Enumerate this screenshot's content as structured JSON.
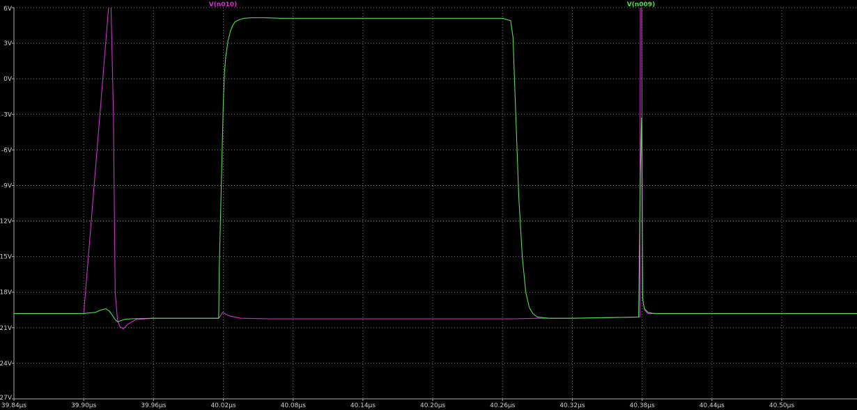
{
  "chart_data": {
    "type": "line",
    "title": "",
    "xlabel": "",
    "ylabel": "",
    "grid": true,
    "xlim": [
      39.84,
      40.5647
    ],
    "ylim": [
      -27,
      6
    ],
    "x_ticks": [
      39.84,
      39.9,
      39.96,
      40.02,
      40.08,
      40.14,
      40.2,
      40.26,
      40.32,
      40.38,
      40.44,
      40.5
    ],
    "x_tick_labels": [
      "39.84µs",
      "39.90µs",
      "39.96µs",
      "40.02µs",
      "40.08µs",
      "40.14µs",
      "40.20µs",
      "40.26µs",
      "40.32µs",
      "40.38µs",
      "40.44µs",
      "40.50µs"
    ],
    "y_ticks": [
      6,
      3,
      0,
      -3,
      -6,
      -9,
      -12,
      -15,
      -18,
      -21,
      -24,
      -27
    ],
    "y_tick_labels": [
      "6V",
      "3V",
      "0V",
      "-3V",
      "-6V",
      "-9V",
      "-12V",
      "-15V",
      "-18V",
      "-21V",
      "-24V",
      "-27V"
    ],
    "colors": {
      "background": "#000000",
      "grid": "#7a7a7a",
      "axis": "#b0b0b0",
      "text": "#d0d0d0"
    },
    "series": [
      {
        "name": "V(n010)",
        "color": "#d030d0",
        "x": [
          39.84,
          39.9,
          39.923,
          39.9255,
          39.927,
          39.929,
          39.931,
          39.934,
          39.938,
          39.945,
          39.96,
          39.99,
          40.016,
          40.0195,
          40.025,
          40.035,
          40.06,
          40.1,
          40.2,
          40.27,
          40.29,
          40.32,
          40.378,
          40.3785,
          40.3795,
          40.3805,
          40.382,
          40.385,
          40.39,
          40.42,
          40.5647
        ],
        "y": [
          -19.8,
          -19.8,
          8,
          -3,
          -18,
          -20.3,
          -20.9,
          -21.1,
          -20.7,
          -20.3,
          -20.2,
          -20.2,
          -20.2,
          -19.7,
          -20.0,
          -20.2,
          -20.25,
          -20.25,
          -20.25,
          -20.25,
          -20.2,
          -20.2,
          -20.1,
          8,
          8,
          -18.5,
          -19.5,
          -19.8,
          -19.8,
          -19.8,
          -19.8
        ]
      },
      {
        "name": "V(n009)",
        "color": "#50e050",
        "x": [
          39.84,
          39.9,
          39.91,
          39.915,
          39.919,
          39.922,
          39.925,
          39.927,
          39.929,
          39.932,
          39.935,
          39.94,
          39.96,
          40.0,
          40.016,
          40.0165,
          40.018,
          40.019,
          40.02,
          40.021,
          40.022,
          40.024,
          40.026,
          40.028,
          40.03,
          40.034,
          40.038,
          40.045,
          40.055,
          40.07,
          40.26,
          40.267,
          40.269,
          40.271,
          40.274,
          40.277,
          40.28,
          40.283,
          40.286,
          40.29,
          40.3,
          40.32,
          40.377,
          40.3785,
          40.3795,
          40.3805,
          40.3815,
          40.382,
          40.385,
          40.39,
          40.42,
          40.5647
        ],
        "y": [
          -19.8,
          -19.8,
          -19.7,
          -19.5,
          -19.4,
          -19.6,
          -20.0,
          -20.3,
          -20.5,
          -20.4,
          -20.3,
          -20.25,
          -20.2,
          -20.2,
          -20.2,
          -16,
          -10,
          -6,
          -2,
          0.5,
          1.8,
          3.2,
          4.0,
          4.5,
          4.8,
          5.0,
          5.1,
          5.15,
          5.15,
          5.1,
          5.1,
          4.9,
          3.5,
          -2,
          -10,
          -15,
          -18,
          -19.3,
          -19.8,
          -20.1,
          -20.2,
          -20.2,
          -20.1,
          -8,
          -3.3,
          -18.5,
          -19.2,
          -19.4,
          -19.7,
          -19.8,
          -19.8,
          -19.8
        ]
      }
    ]
  }
}
